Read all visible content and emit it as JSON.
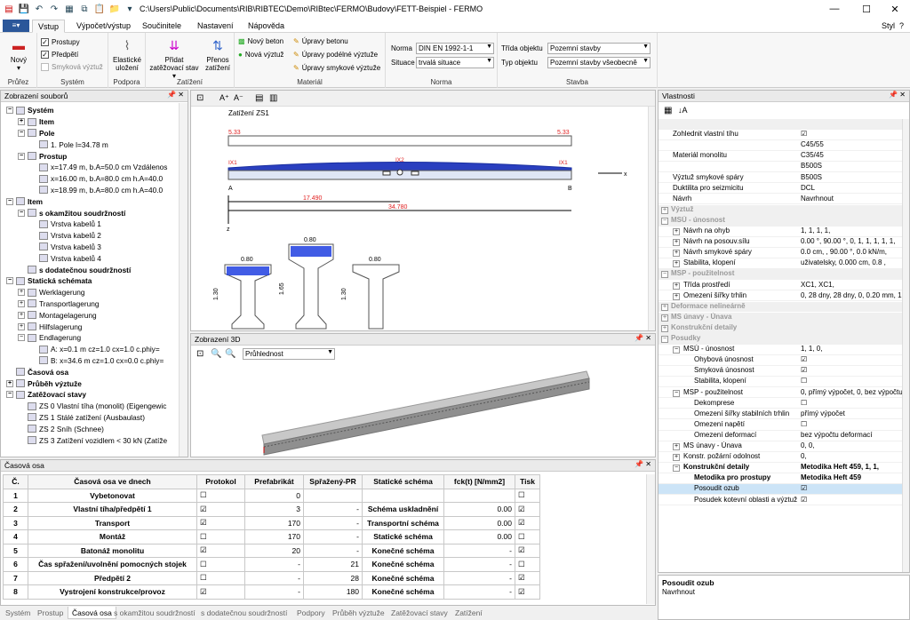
{
  "window": {
    "title": "C:\\Users\\Public\\Documents\\RIB\\RIBTEC\\Demo\\RIBtec\\FERMO\\Budovy\\FETT-Beispiel - FERMO",
    "minimize": "—",
    "maximize": "☐",
    "close": "✕",
    "help": "?",
    "style_label": "Styl"
  },
  "ribbon_tabs": [
    "Vstup",
    "Výpočet/výstup",
    "Součinitele",
    "Nastavení",
    "Nápověda"
  ],
  "ribbon": {
    "prurez": {
      "label": "Průřez",
      "new": "Nový"
    },
    "system": {
      "label": "Systém",
      "prostupy": "Prostupy",
      "predpeti": "Předpětí",
      "smykova": "Smyková výztuž"
    },
    "podpora": {
      "label": "Podpora",
      "elasticke": "Elastické uložení"
    },
    "zatizeni": {
      "label": "Zatížení",
      "pridat": "Přidat zatěžovací stav",
      "prenos": "Přenos zatížení"
    },
    "material": {
      "label": "Materiál",
      "novy_beton": "Nový beton",
      "nova_vyztuz": "Nová výztuž",
      "upravy_betonu": "Úpravy betonu",
      "upravy_podelne": "Úpravy podélné výztuže",
      "upravy_smykove": "Úpravy smykové výztuže"
    },
    "norma": {
      "label": "Norma",
      "norma_label": "Norma",
      "norma_value": "DIN EN 1992-1-1",
      "situace_label": "Situace",
      "situace_value": "trvalá situace"
    },
    "stavba": {
      "label": "Stavba",
      "trida_label": "Třída objektu",
      "trida_value": "Pozemní stavby",
      "typ_label": "Typ objektu",
      "typ_value": "Pozemní stavby všeobecně"
    }
  },
  "file_panel": {
    "title": "Zobrazení souborů",
    "tree": [
      {
        "t": "Systém",
        "b": true,
        "lvl": 0,
        "e": "−"
      },
      {
        "t": "Item",
        "b": true,
        "lvl": 1,
        "e": "+"
      },
      {
        "t": "Pole",
        "b": true,
        "lvl": 1,
        "e": "−"
      },
      {
        "t": "1. Pole  l=34.78 m",
        "b": false,
        "lvl": 2,
        "e": ""
      },
      {
        "t": "Prostup",
        "b": true,
        "lvl": 1,
        "e": "−"
      },
      {
        "t": "x=17.49 m, b.A=50.0 cm Vzdálenos",
        "b": false,
        "lvl": 2,
        "e": ""
      },
      {
        "t": "x=16.00 m, b.A=80.0 cm h.A=40.0",
        "b": false,
        "lvl": 2,
        "e": ""
      },
      {
        "t": "x=18.99 m, b.A=80.0 cm h.A=40.0",
        "b": false,
        "lvl": 2,
        "e": ""
      },
      {
        "t": "Item",
        "b": true,
        "lvl": 0,
        "e": "−"
      },
      {
        "t": "s okamžitou soudržností",
        "b": true,
        "lvl": 1,
        "e": "−"
      },
      {
        "t": "Vrstva kabelů 1",
        "b": false,
        "lvl": 2,
        "e": ""
      },
      {
        "t": "Vrstva kabelů 2",
        "b": false,
        "lvl": 2,
        "e": ""
      },
      {
        "t": "Vrstva kabelů 3",
        "b": false,
        "lvl": 2,
        "e": ""
      },
      {
        "t": "Vrstva kabelů 4",
        "b": false,
        "lvl": 2,
        "e": ""
      },
      {
        "t": "s dodatečnou soudržností",
        "b": true,
        "lvl": 1,
        "e": ""
      },
      {
        "t": "Statická schémata",
        "b": true,
        "lvl": 0,
        "e": "−"
      },
      {
        "t": "Werklagerung",
        "b": false,
        "lvl": 1,
        "e": "+"
      },
      {
        "t": "Transportlagerung",
        "b": false,
        "lvl": 1,
        "e": "+"
      },
      {
        "t": "Montagelagerung",
        "b": false,
        "lvl": 1,
        "e": "+"
      },
      {
        "t": "Hilfslagerung",
        "b": false,
        "lvl": 1,
        "e": "+"
      },
      {
        "t": "Endlagerung",
        "b": false,
        "lvl": 1,
        "e": "−"
      },
      {
        "t": "A: x=0.1 m  cz=1.0 cx=1.0 c.phiy=",
        "b": false,
        "lvl": 2,
        "e": ""
      },
      {
        "t": "B: x=34.6 m  cz=1.0 cx=0.0 c.phiy=",
        "b": false,
        "lvl": 2,
        "e": ""
      },
      {
        "t": "Časová osa",
        "b": true,
        "lvl": 0,
        "e": ""
      },
      {
        "t": "Průběh výztuže",
        "b": true,
        "lvl": 0,
        "e": "+"
      },
      {
        "t": "Zatěžovací stavy",
        "b": true,
        "lvl": 0,
        "e": "−"
      },
      {
        "t": "ZS 0 Vlastní tíha (monolit) (Eigengewic",
        "b": false,
        "lvl": 1,
        "e": ""
      },
      {
        "t": "ZS 1 Stálé zatížení (Ausbaulast)",
        "b": false,
        "lvl": 1,
        "e": ""
      },
      {
        "t": "ZS 2 Sníh (Schnee)",
        "b": false,
        "lvl": 1,
        "e": ""
      },
      {
        "t": "ZS 3 Zatížení vozidlem < 30 kN (Zatíže",
        "b": false,
        "lvl": 1,
        "e": ""
      }
    ]
  },
  "drawing": {
    "title": "Zatížení ZS1",
    "load_left": "5.33",
    "load_right": "5.33",
    "ix1_left": "IX1",
    "ix2": "IX2",
    "ix1_right": "IX1",
    "support_a": "A",
    "support_b": "B",
    "axis_x": "x",
    "axis_z": "z",
    "dim1": "17.490",
    "dim2": "34.780",
    "w1": "0.80",
    "w2": "0.80",
    "w3": "0.80",
    "h1": "1.30",
    "h2": "1.65",
    "h3": "1.30"
  },
  "view3d": {
    "title": "Zobrazení 3D",
    "mode": "Průhlednost"
  },
  "properties": {
    "title": "Vlastnosti",
    "rows": [
      {
        "k": "",
        "v": "",
        "type": "cat"
      },
      {
        "k": "Zohlednit vlastní tíhu",
        "v": "☑",
        "type": "row"
      },
      {
        "k": "",
        "v": "C45/55",
        "type": "row"
      },
      {
        "k": "Materiál monolitu",
        "v": "C35/45",
        "type": "row"
      },
      {
        "k": "",
        "v": "B500S",
        "type": "row"
      },
      {
        "k": "Výztuž smykové spáry",
        "v": "B500S",
        "type": "row"
      },
      {
        "k": "Duktilita pro seizmicitu",
        "v": "DCL",
        "type": "row"
      },
      {
        "k": "Návrh",
        "v": "Navrhnout",
        "type": "row"
      },
      {
        "k": "Výztuž",
        "v": "",
        "type": "cat",
        "e": "+"
      },
      {
        "k": "MSÚ - únosnost",
        "v": "",
        "type": "cat",
        "e": "−"
      },
      {
        "k": "Návrh na ohyb",
        "v": "1, 1, 1, 1,",
        "type": "sub",
        "e": "+"
      },
      {
        "k": "Návrh na posouv.sílu",
        "v": "0.00 °, 90.00 °, 0, 1, 1, 1, 1, 1,",
        "type": "sub",
        "e": "+"
      },
      {
        "k": "Návrh smykové spáry",
        "v": "0.0 cm, , 90.00 °, 0.0 kN/m,",
        "type": "sub",
        "e": "+"
      },
      {
        "k": "Stabilita, klopení",
        "v": "uživatelsky, 0.000 cm, 0.8 ,",
        "type": "sub",
        "e": "+"
      },
      {
        "k": "MSP - použitelnost",
        "v": "",
        "type": "cat",
        "e": "−"
      },
      {
        "k": "Třída prostředí",
        "v": "XC1, XC1,",
        "type": "sub",
        "e": "+"
      },
      {
        "k": "Omezení šířky trhlin",
        "v": "0, 28 dny, 28 dny, 0, 0.20 mm, 1,...",
        "type": "sub",
        "e": "+"
      },
      {
        "k": "Deformace nelineárně",
        "v": "",
        "type": "cat",
        "e": "+"
      },
      {
        "k": "MS únavy - Únava",
        "v": "",
        "type": "cat",
        "e": "+"
      },
      {
        "k": "Konstrukční detaily",
        "v": "",
        "type": "cat",
        "e": "+"
      },
      {
        "k": "Posudky",
        "v": "",
        "type": "cat",
        "e": "−"
      },
      {
        "k": "MSÚ - únosnost",
        "v": "1, 1, 0,",
        "type": "sub",
        "e": "−"
      },
      {
        "k": "Ohybová únosnost",
        "v": "☑",
        "type": "sub2"
      },
      {
        "k": "Smyková únosnost",
        "v": "☑",
        "type": "sub2"
      },
      {
        "k": "Stabilita, klopení",
        "v": "☐",
        "type": "sub2"
      },
      {
        "k": "MSP - použitelnost",
        "v": "0, přímý výpočet, 0, bez výpočtu...",
        "type": "sub",
        "e": "−"
      },
      {
        "k": "Dekomprese",
        "v": "☐",
        "type": "sub2"
      },
      {
        "k": "Omezení šířky stabilních trhlin",
        "v": "přímý výpočet",
        "type": "sub2"
      },
      {
        "k": "Omezení napětí",
        "v": "☐",
        "type": "sub2"
      },
      {
        "k": "Omezení deformací",
        "v": "bez výpočtu deformací",
        "type": "sub2"
      },
      {
        "k": "MS únavy - Únava",
        "v": "0, 0,",
        "type": "sub",
        "e": "+"
      },
      {
        "k": "Konstr. požární odolnost",
        "v": "0,",
        "type": "sub",
        "e": "+"
      },
      {
        "k": "Konstrukční detaily",
        "v": "Metodika Heft 459, 1, 1,",
        "type": "sub",
        "e": "−",
        "bold": true
      },
      {
        "k": "Metodika pro prostupy",
        "v": "Metodika Heft 459",
        "type": "sub2",
        "bold": true
      },
      {
        "k": "Posoudit ozub",
        "v": "☑",
        "type": "sub2",
        "sel": true
      },
      {
        "k": "Posudek kotevní oblasti a výztuž...",
        "v": "☑",
        "type": "sub2"
      }
    ],
    "desc_title": "Posoudit ozub",
    "desc_text": "Navrhnout"
  },
  "timeline": {
    "title": "Časová osa",
    "headers": [
      "Č.",
      "Časová osa ve dnech",
      "Protokol",
      "Prefabrikát",
      "Spřažený-PR",
      "Statické schéma",
      "fck(t) [N/mm2]",
      "Tisk"
    ],
    "rows": [
      [
        "1",
        "Vybetonovat",
        "☐",
        "0",
        "",
        "",
        "",
        "☐"
      ],
      [
        "2",
        "Vlastní tíha/předpětí 1",
        "☑",
        "3",
        "-",
        "Schéma uskladnění",
        "0.00",
        "☑"
      ],
      [
        "3",
        "Transport",
        "☑",
        "170",
        "-",
        "Transportní schéma",
        "0.00",
        "☑"
      ],
      [
        "4",
        "Montáž",
        "☐",
        "170",
        "-",
        "Statické schéma",
        "0.00",
        "☐"
      ],
      [
        "5",
        "Batonáž monolitu",
        "☑",
        "20",
        "-",
        "Konečné schéma",
        "-",
        "☑"
      ],
      [
        "6",
        "Čas spřažení/uvolnění pomocných stojek",
        "☐",
        "-",
        "21",
        "Konečné schéma",
        "-",
        "☐"
      ],
      [
        "7",
        "Předpětí 2",
        "☐",
        "-",
        "28",
        "Konečné schéma",
        "-",
        "☑"
      ],
      [
        "8",
        "Vystrojení konstrukce/provoz",
        "☑",
        "-",
        "180",
        "Konečné schéma",
        "-",
        "☑"
      ]
    ]
  },
  "bottom_tabs": [
    "Systém",
    "Prostup",
    "Časová osa",
    "s okamžitou soudržností",
    "s dodatečnou soudržností",
    "Podpory",
    "Průběh výztuže",
    "Zatěžovací stavy",
    "Zatížení"
  ],
  "colors": {
    "accent": "#2b579a",
    "load_red": "#e02020",
    "beam_blue": "#1a2fa0",
    "tendon_blue": "#2040e0"
  }
}
